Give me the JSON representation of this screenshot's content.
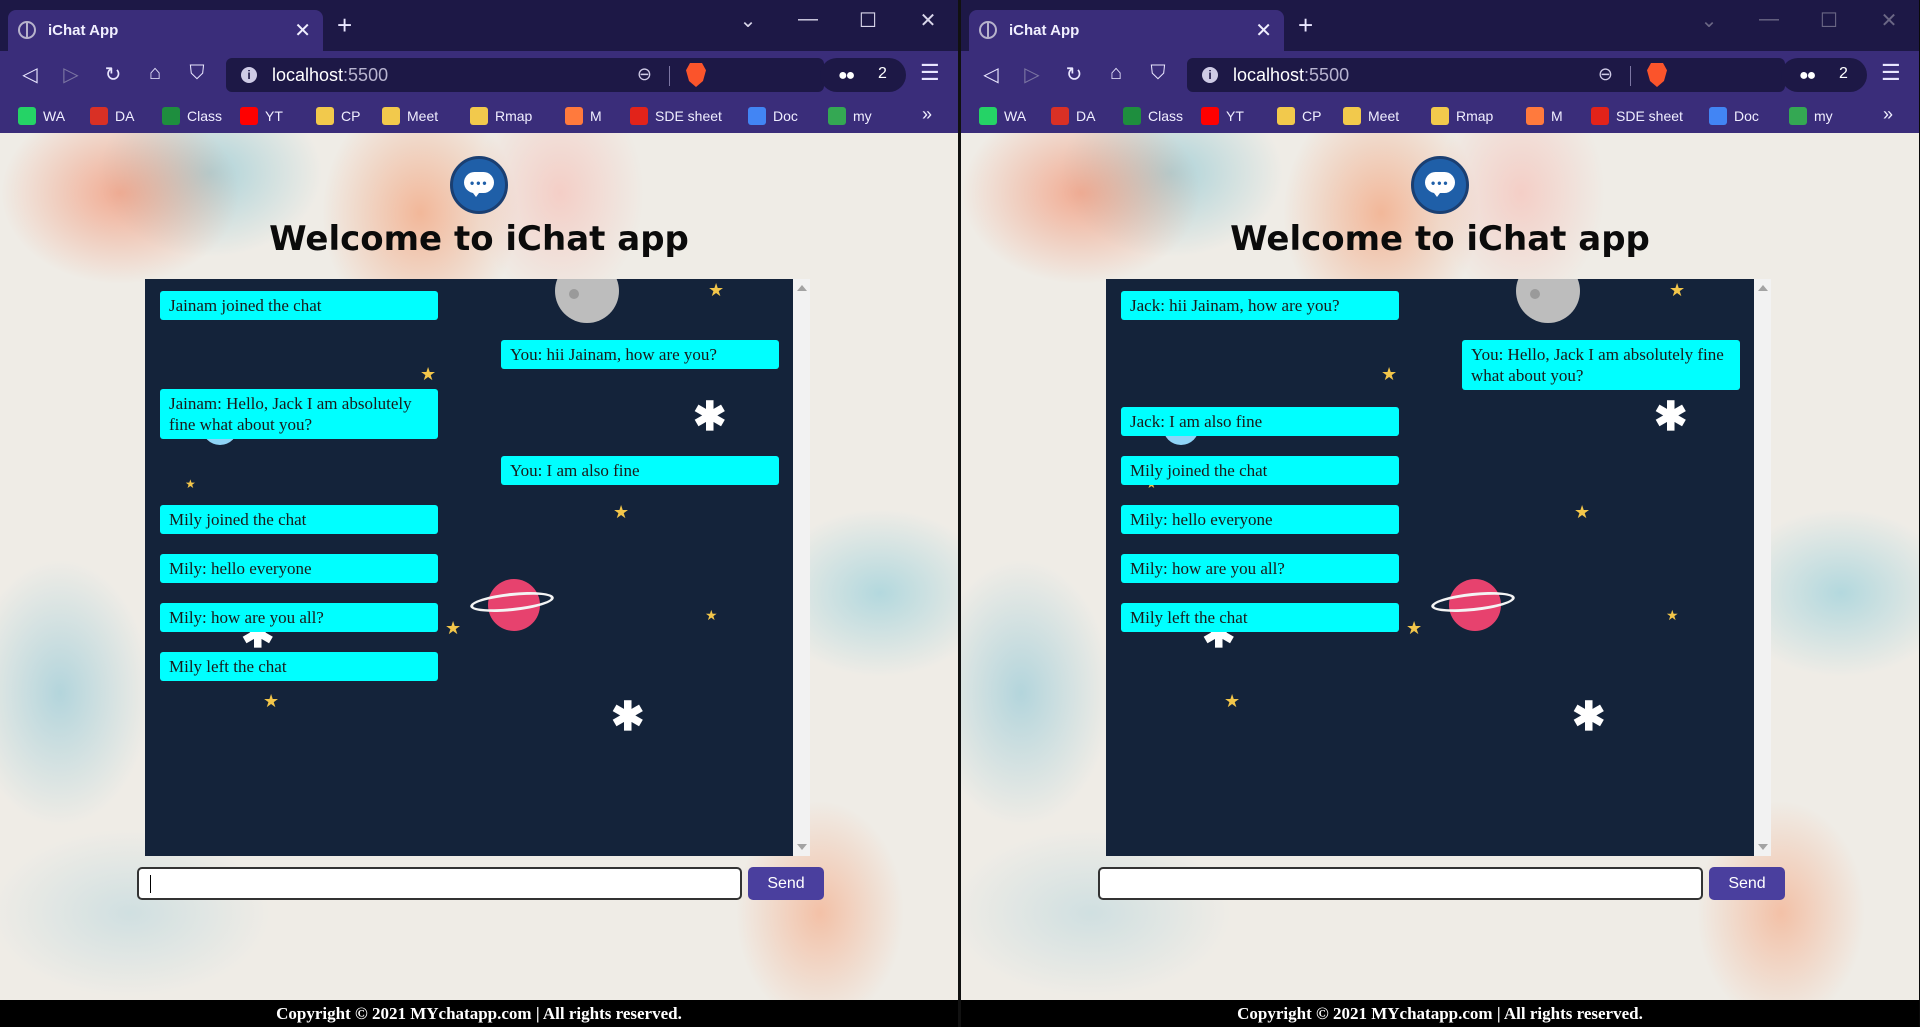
{
  "browser": {
    "tab_title": "iChat App",
    "tab_close": "✕",
    "new_tab": "+",
    "url_host": "localhost",
    "url_port": ":5500",
    "shields_count": "2",
    "bookmarks": [
      {
        "label": "WA",
        "icon": "whatsapp-icon",
        "color": "#25d366"
      },
      {
        "label": "DA",
        "icon": "gmail-icon",
        "color": "#d93025"
      },
      {
        "label": "Class",
        "icon": "classroom-icon",
        "color": "#1e8e3e"
      },
      {
        "label": "YT",
        "icon": "youtube-icon",
        "color": "#ff0000"
      },
      {
        "label": "CP",
        "icon": "folder-icon",
        "color": "#f2c94c"
      },
      {
        "label": "Meet",
        "icon": "folder-icon",
        "color": "#f2c94c"
      },
      {
        "label": "Rmap",
        "icon": "folder-icon",
        "color": "#f2c94c"
      },
      {
        "label": "M",
        "icon": "medium-icon",
        "color": "#ff7a3d"
      },
      {
        "label": "SDE sheet",
        "icon": "tuf-icon",
        "color": "#e2231a"
      },
      {
        "label": "Doc",
        "icon": "docs-icon",
        "color": "#4285f4"
      },
      {
        "label": "my",
        "icon": "drive-icon",
        "color": "#34a853"
      }
    ],
    "bookmarks_more": "»"
  },
  "page": {
    "title": "Welcome to iChat app",
    "send_label": "Send",
    "input_value": "",
    "footer": "Copyright © 2021 MYchatapp.com | All rights reserved."
  },
  "windows": [
    {
      "messages": [
        {
          "side": "left",
          "text": "Jainam joined the chat"
        },
        {
          "side": "right",
          "text": "You: hii Jainam, how are you?"
        },
        {
          "side": "left",
          "text": "Jainam: Hello, Jack I am absolutely fine what about you?"
        },
        {
          "side": "right",
          "text": "You: I am also fine"
        },
        {
          "side": "left",
          "text": "Mily joined the chat"
        },
        {
          "side": "left",
          "text": "Mily: hello everyone"
        },
        {
          "side": "left",
          "text": "Mily: how are you all?"
        },
        {
          "side": "left",
          "text": "Mily left the chat"
        }
      ]
    },
    {
      "messages": [
        {
          "side": "left",
          "text": "Jack: hii Jainam, how are you?"
        },
        {
          "side": "right",
          "text": "You: Hello, Jack I am absolutely fine what about you?"
        },
        {
          "side": "left",
          "text": "Jack: I am also fine"
        },
        {
          "side": "left",
          "text": "Mily joined the chat"
        },
        {
          "side": "left",
          "text": "Mily: hello everyone"
        },
        {
          "side": "left",
          "text": "Mily: how are you all?"
        },
        {
          "side": "left",
          "text": "Mily left the chat"
        }
      ]
    }
  ]
}
